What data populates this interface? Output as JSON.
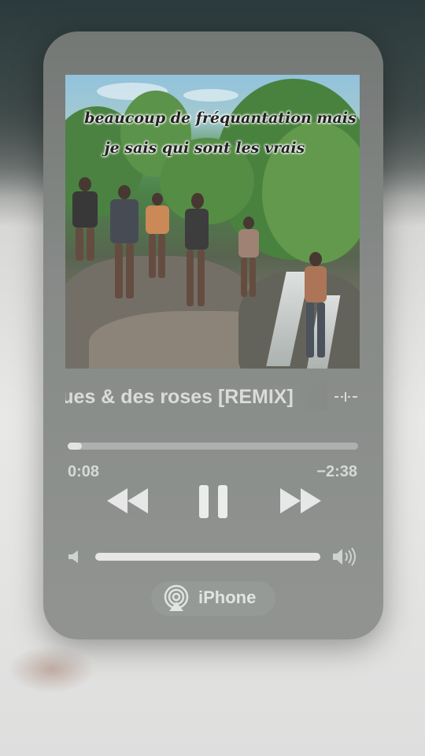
{
  "artwork": {
    "caption_line1": "beaucoup de fréquantation mais",
    "caption_line2": "je sais qui sont les vrais"
  },
  "now_playing": {
    "title": "gues & des roses [REMIX]",
    "more_icon": "waveform-more-icon"
  },
  "playback": {
    "elapsed": "0:08",
    "remaining": "−2:38",
    "progress_fraction": 0.048
  },
  "controls": {
    "previous_icon": "rewind-icon",
    "play_pause_icon": "pause-icon",
    "next_icon": "fast-forward-icon"
  },
  "volume": {
    "low_icon": "speaker-low-icon",
    "high_icon": "speaker-high-icon",
    "level_fraction": 1.0
  },
  "output": {
    "device_label": "iPhone",
    "icon": "airplay-icon"
  }
}
